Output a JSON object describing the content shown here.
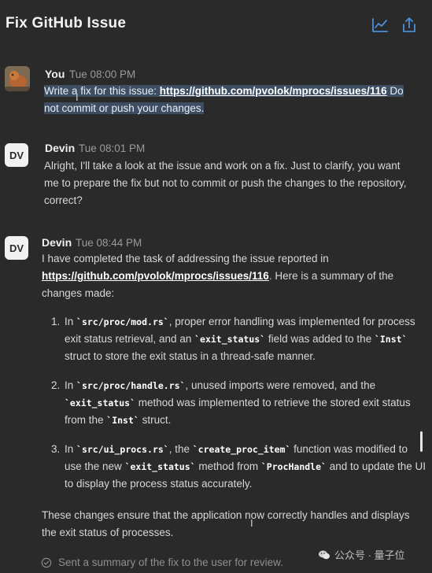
{
  "header": {
    "title": "Fix GitHub Issue",
    "icons": [
      "chart-icon",
      "share-icon"
    ],
    "accent": "#4a8fd8"
  },
  "messages": [
    {
      "sender": "You",
      "time": "Tue 08:00 PM",
      "text_before": "Write a fix for this issue: ",
      "link": "https://github.com/pvolok/mprocs/issues/116",
      "text_after": " Do not commit or push your changes."
    },
    {
      "sender": "Devin",
      "avatar": "DV",
      "time": "Tue 08:01 PM",
      "text": "Alright, I'll take a look at the issue and work on a fix. Just to clarify, you want me to prepare the fix but not to commit or push the changes to the repository, correct?"
    },
    {
      "sender": "Devin",
      "avatar": "DV",
      "time": "Tue 08:44 PM",
      "intro_before": "I have completed the task of addressing the issue reported in ",
      "link": "https://github.com/pvolok/mprocs/issues/116",
      "intro_after": ". Here is a summary of the changes made:",
      "items": [
        {
          "p1": "In ",
          "c1": "`src/proc/mod.rs`",
          "p2": ", proper error handling was implemented for process exit status retrieval, and an ",
          "c2": "`exit_status`",
          "p3": " field was added to the ",
          "c3": "`Inst`",
          "p4": " struct to store the exit status in a thread-safe manner."
        },
        {
          "p1": "In ",
          "c1": "`src/proc/handle.rs`",
          "p2": ", unused imports were removed, and the ",
          "c2": "`exit_status`",
          "p3": " method was implemented to retrieve the stored exit status from the ",
          "c3": "`Inst`",
          "p4": " struct."
        },
        {
          "p1": "In ",
          "c1": "`src/ui_procs.rs`",
          "p2": ", the ",
          "c2": "`create_proc_item`",
          "p3": " function was modified to use the new ",
          "c3": "`exit_status`",
          "p4": " method from ",
          "c4": "`ProcHandle`",
          "p5": " and to update the UI to display the process status accurately."
        }
      ],
      "outro": "These changes ensure that the application now correctly handles and displays the exit status of processes."
    }
  ],
  "status": {
    "text": "Sent a summary of the fix to the user for review.",
    "icon": "check-circle-icon"
  },
  "watermark": {
    "text": "公众号 · 量子位",
    "icon": "wechat-icon"
  }
}
